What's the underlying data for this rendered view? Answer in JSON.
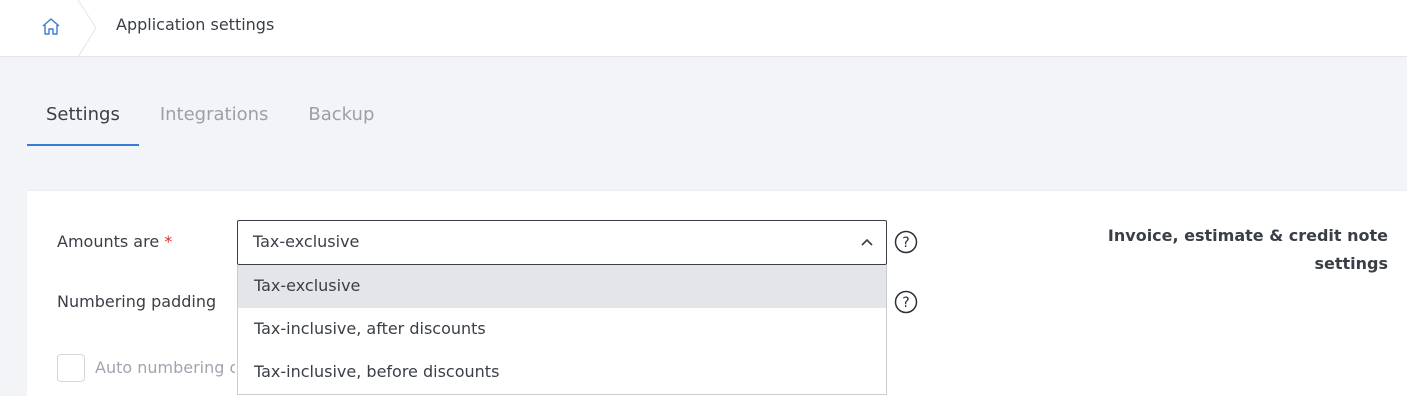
{
  "header": {
    "home_icon": "home-icon",
    "title": "Application settings"
  },
  "tabs": [
    {
      "label": "Settings",
      "active": true
    },
    {
      "label": "Integrations",
      "active": false
    },
    {
      "label": "Backup",
      "active": false
    }
  ],
  "form": {
    "amounts": {
      "label": "Amounts are",
      "required_mark": "*",
      "value": "Tax-exclusive",
      "options": [
        "Tax-exclusive",
        "Tax-inclusive, after discounts",
        "Tax-inclusive, before discounts"
      ],
      "selected_option": "Tax-exclusive"
    },
    "numbering_padding": {
      "label": "Numbering padding"
    },
    "auto_numbering": {
      "label": "Auto numbering of",
      "checked": false
    },
    "help_icon": "question-circle-icon"
  },
  "side_panel": {
    "title": "Invoice, estimate & credit note settings"
  },
  "colors": {
    "accent": "#3a7bd5",
    "required": "#d93025",
    "page_bg": "#f3f4f8"
  }
}
